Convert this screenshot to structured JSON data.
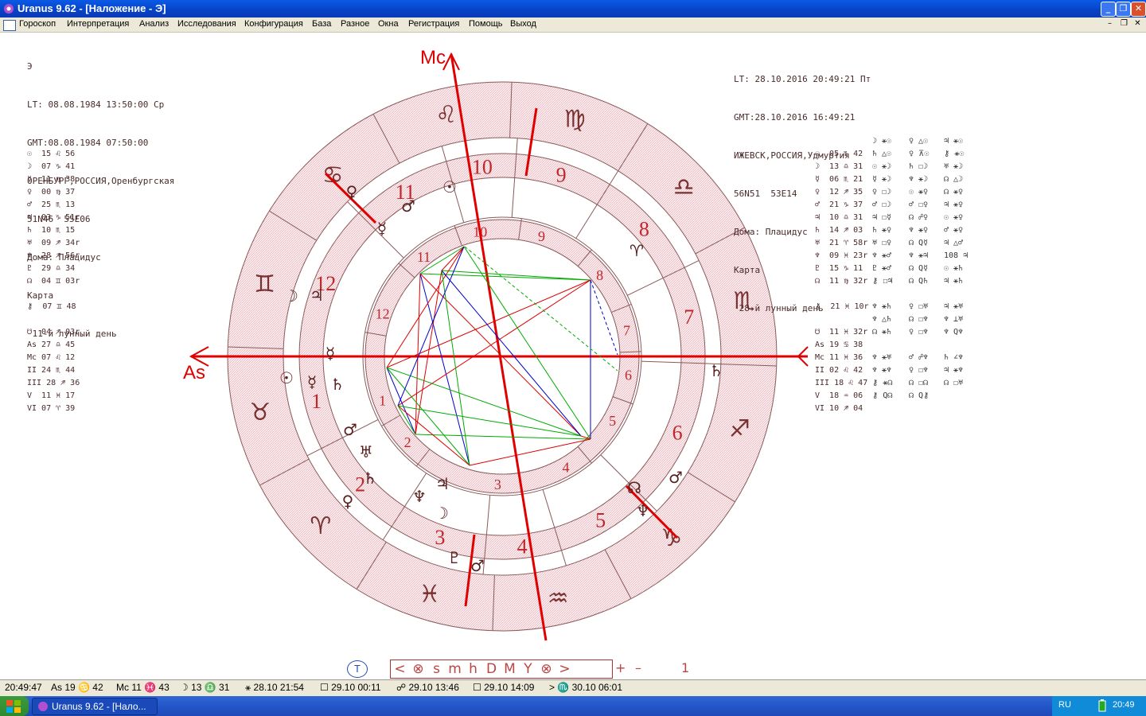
{
  "window": {
    "title": "Uranus 9.62 - [Наложение  - Э]"
  },
  "menu": [
    "Гороскоп",
    "Интерпретация",
    "Анализ",
    "Исследования",
    "Конфигурация",
    "База",
    "Разное",
    "Окна",
    "Регистрация",
    "Помощь",
    "Выход"
  ],
  "left_chart": {
    "lines": [
      "Э",
      "LT: 08.08.1984 13:50:00 Ср",
      "GMT:08.08.1984 07:50:00",
      "ОРЕНБУРГ,РОССИЯ,Оренбургская",
      "51N46  55E06",
      "Дома: Плацидус",
      "Карта",
      " 11-й лунный день"
    ],
    "planets": [
      "☉  15 ♌ 56",
      "☽  07 ♑ 41",
      "☿  11 ♍ 38",
      "♀  00 ♍ 37",
      "♂  25 ♏ 13",
      "♃  03 ♑ 51r",
      "♄  10 ♏ 15",
      "♅  09 ♐ 34r",
      "♆  28 ♐ 56r",
      "♇  29 ♎ 34",
      "☊  04 ♊ 03r",
      "",
      "⚷  07 ♊ 48",
      "",
      "☋  04 ♐ 03r",
      "As 27 ♎ 45",
      "Mc 07 ♌ 12",
      "II 24 ♏ 44",
      "III 28 ♐ 36",
      "V  11 ♓ 17",
      "VI 07 ♈ 39"
    ]
  },
  "right_chart": {
    "lines": [
      "LT: 28.10.2016 20:49:21 Пт",
      "GMT:28.10.2016 16:49:21",
      "ИЖЕВСК,РОССИЯ,Удмуртия",
      "56N51  53E14",
      "Дома: Плацидус",
      "Карта",
      " 28-й лунный день"
    ],
    "planets": [
      "☉  05 ♏ 42",
      "☽  13 ♎ 31",
      "☿  06 ♏ 21",
      "♀  12 ♐ 35",
      "♂  21 ♑ 37",
      "♃  10 ♎ 31",
      "♄  14 ♐ 03",
      "♅  21 ♈ 58r",
      "♆  09 ♓ 23r",
      "♇  15 ♑ 11",
      "☊  11 ♍ 32r",
      "",
      "⚷  21 ♓ 10r",
      "",
      "☋  11 ♓ 32r",
      "As 19 ♋ 38",
      "Mc 11 ♓ 36",
      "II 02 ♌ 42",
      "III 18 ♌ 47",
      "V  18 ♒ 06",
      "VI 10 ♐ 04"
    ]
  },
  "aspect_cols": [
    [
      "☽ ⚹☉",
      "♄ △☉",
      "☉ ⚹☽",
      "☿ ⚹☽",
      "♀ ☐☽",
      "♂ ☐☽",
      "♃ ☐☿",
      "♄ ⚹♀",
      "♅ ☐♀",
      "♆ ⚹♂",
      "♇ ⚹♂",
      "⚷ ☐♃",
      "",
      "♆ ⚹♄",
      "♆ △♄",
      "☊ ⚹♄",
      "",
      "♆ ⚹♅",
      "♆ ⚹♆",
      "⚷ ⚹☊",
      "⚷ Q☊"
    ],
    [
      "♀ △☉",
      "♀ ⊼☉",
      "♄ ☐☽",
      "♆ ⚹☽",
      "☉ ⚹♀",
      "♂ ☐♀",
      "☊ ☍♀",
      "♆ ⚹♀",
      "☊ Q☿",
      "♆ ⚹♃",
      "☊ Q☿",
      "☊ Q♄",
      "",
      "♀ ☐♅",
      "☊ ☐♆",
      "♀ ☐♆",
      "",
      "♂ ☍♆",
      "♀ ☐♆",
      "☊ ☐☊",
      "☊ Q⚷"
    ],
    [
      "♃ ⚹☉",
      "⚷ ⚹☉",
      "♅ ⚹☽",
      "☊ △☽",
      "☊ ⚹♀",
      "♃ ⚹♀",
      "☉ ⚹♀",
      "♂ ⚹♀",
      "♃ △♂",
      "108 ♃",
      "☉ ⚹♄",
      "♃ ⚹♄",
      "",
      "♃ ⚹♅",
      "♆ ⊥♅",
      "♆ Q♆",
      "",
      "♄ ∠♆",
      "♃ ⚹♆",
      "☊ ☐♅",
      ""
    ]
  ],
  "navbar": [
    "<",
    "⊗",
    "s",
    "m",
    "h",
    "D",
    "M",
    "Y",
    "⊗",
    ">"
  ],
  "nav_t": "T",
  "nav_plus": "+",
  "nav_minus": "–",
  "nav_count": "1",
  "status": [
    "20:49:47",
    "As 19 ♋ 42",
    "Mc 11 ♓ 43",
    "☽ 13 ♎ 31",
    "⚹ 28.10 21:54",
    "☐ 29.10 00:11",
    "☍ 29.10 13:46",
    "☐ 29.10 14:09",
    "> ♏ 30.10 06:01"
  ],
  "taskbar": {
    "task": "Uranus 9.62 - [Нало...",
    "lang": "RU",
    "clock": "20:49"
  },
  "wheel": {
    "zodiac_glyphs": [
      "♈",
      "♉",
      "♊",
      "♋",
      "♌",
      "♍",
      "♎",
      "♏",
      "♐",
      "♑",
      "♒",
      "♓"
    ],
    "outer_house_numbers": [
      "1",
      "2",
      "3",
      "4",
      "5",
      "6",
      "7",
      "8",
      "9",
      "10",
      "11",
      "12"
    ],
    "inner_house_numbers": [
      "1",
      "2",
      "3",
      "4",
      "5",
      "6",
      "7",
      "8",
      "9",
      "10",
      "11",
      "12"
    ],
    "axis_labels": {
      "mc": "Mc",
      "as": "As"
    },
    "colors": {
      "ring": "#c98a90",
      "axis": "#e00000",
      "text": "#c0262a",
      "planet": "#5a2020"
    }
  }
}
